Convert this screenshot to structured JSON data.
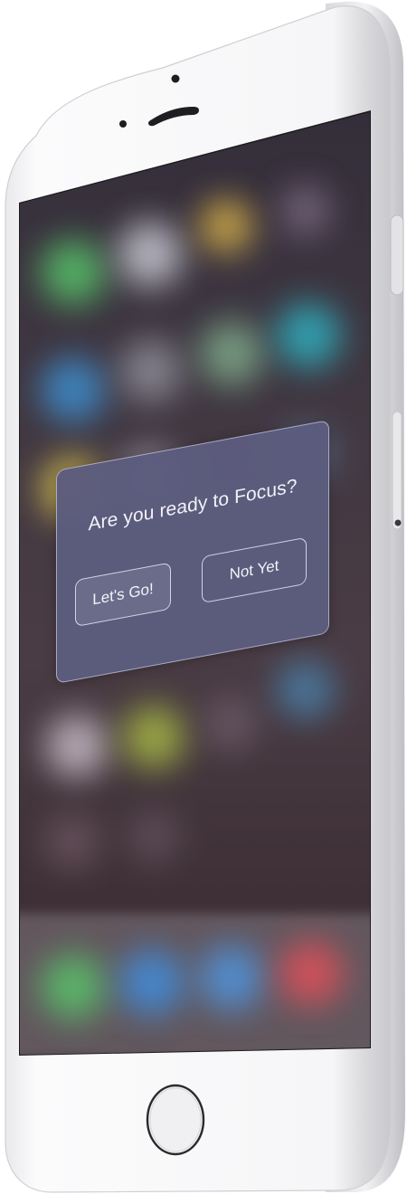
{
  "device": {
    "model": "iPhone",
    "colors": {
      "body": "#f4f4f6",
      "bezel_edge": "#d7d7da",
      "screen_border": "#1c1c1e"
    }
  },
  "home_screen": {
    "wallpaper_state": "blurred",
    "app_icon_colors": [
      "#58c36a",
      "#c8c8d2",
      "#d9b24a",
      "#3e8fd0",
      "#8d8d98",
      "#7ea98a",
      "#2fb0c0",
      "#d6c24f",
      "#c7bbc6",
      "#a6b845",
      "#4a7fa8",
      "#59c46a",
      "#3f8fe0",
      "#4f95df",
      "#e0505a"
    ]
  },
  "focus_dialog": {
    "title": "Are you ready to Focus?",
    "confirm_label": "Let's Go!",
    "decline_label": "Not Yet",
    "colors": {
      "background": "#5c5c7e",
      "text": "#f2f2f8",
      "border": "#cdcde6"
    }
  },
  "hardware": {
    "home_button_icon": "home-button",
    "speaker_icon": "earpiece-speaker",
    "camera_icon": "front-camera",
    "sensor_icon": "proximity-sensor",
    "volume_icon": "volume-button",
    "power_icon": "side-button"
  }
}
